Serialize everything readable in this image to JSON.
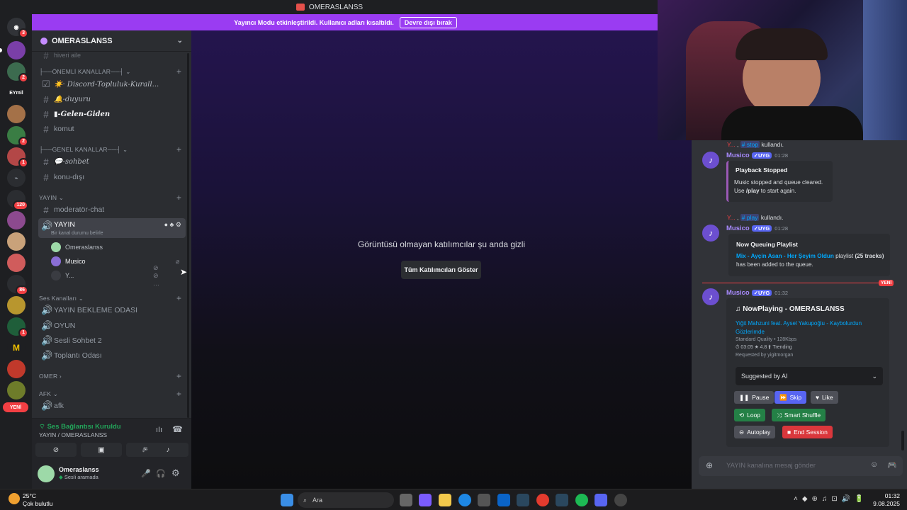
{
  "window": {
    "title": "OMERASLANSS"
  },
  "banner": {
    "text": "Yayıncı Modu etkinleştirildi. Kullanıcı adları kısaltıldı.",
    "button": "Devre dışı bırak"
  },
  "servers": {
    "badges": [
      "3",
      "2",
      "EYmil",
      "2",
      "1",
      "120",
      "86",
      "1",
      "YENİ"
    ]
  },
  "guild": {
    "name": "OMERASLANSS"
  },
  "sidebar": {
    "top_faded": "hiveri aile",
    "cat_important": "ÖNEMLİ KANALLAR",
    "ch_rules": "· Discord-Topluluk-Kurall...",
    "ch_duyuru": "-duyuru",
    "ch_gelen": "-Gelen-Giden",
    "ch_komut": "komut",
    "cat_general": "GENEL KANALLAR",
    "ch_sohbet": "-sohbet",
    "ch_konu": "konu-dışı",
    "cat_yayin": "YAYIN",
    "ch_mod": "moderatör-chat",
    "vc_yayin": "YAYIN",
    "vc_status": "Bir kanal durumu belirle",
    "members": [
      "Omeraslanss",
      "Musico",
      "Y..."
    ],
    "cat_voice": "Ses Kanalları",
    "vc_list": [
      "YAYIN BEKLEME ODASI",
      "OYUN",
      "Sesli Sohbet 2",
      "Toplantı Odası"
    ],
    "cat_omer": "OMER",
    "cat_afk": "AFK",
    "vc_afk": "afk"
  },
  "voice": {
    "status": "Ses Bağlantısı Kuruldu",
    "channel": "YAYIN / OMERASLANSS"
  },
  "user": {
    "name": "Omeraslanss",
    "status": "Sesli aramada"
  },
  "stage": {
    "hidden_text": "Görüntüsü olmayan katılımcılar şu anda gizli",
    "show_button": "Tüm Katılımcıları Göster"
  },
  "chat": {
    "sys1_user": "Y...",
    "sys1_cmd": "stop",
    "sys1_tail": "kullandı.",
    "bot_name": "Musico",
    "bot_tag": "✓UYG",
    "m1_time": "01:28",
    "m1_title": "Playback Stopped",
    "m1_line1": "Music stopped and queue cleared.",
    "m1_line2_pre": "Use",
    "m1_line2_cmd": "/play",
    "m1_line2_post": "to start again.",
    "sys2_user": "Y...",
    "sys2_cmd": "play",
    "sys2_tail": "kullandı.",
    "m2_time": "01:28",
    "m2_title": "Now Queuing Playlist",
    "m2_link": "Mix - Ayçin Asan - Her Şeyim Oldun",
    "m2_mid": "playlist",
    "m2_count": "(25 tracks)",
    "m2_tail": "has been added to the queue.",
    "new_badge": "YENİ",
    "m3_time": "01:32",
    "m3_title": "NowPlaying - OMERASLANSS",
    "m3_track": "Yiğit Mahzuni feat. Aysel Yakupoğlu - Kaybolurdun Gözlerimde",
    "m3_quality": "Standard Quality • 128Kbps",
    "m3_stats": "⏱ 03:05  ★ 4.8  ⬆ Trending",
    "m3_req": "Requested by yigitmorgan",
    "m3_select": "Suggested by AI",
    "btn_pause": "Pause",
    "btn_skip": "Skip",
    "btn_like": "Like",
    "btn_loop": "Loop",
    "btn_shuffle": "Smart Shuffle",
    "btn_autoplay": "Autoplay",
    "btn_end": "End Session",
    "input_placeholder": "YAYIN kanalına mesaj gönder"
  },
  "taskbar": {
    "temp": "25°C",
    "weather": "Çok bulutlu",
    "search": "Ara",
    "time": "01:32",
    "date": "9.08.2025"
  }
}
